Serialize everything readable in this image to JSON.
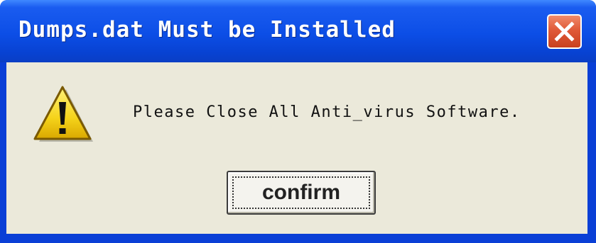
{
  "window": {
    "title": "Dumps.dat Must be Installed",
    "close_icon": "close-icon"
  },
  "content": {
    "icon": "warning-icon",
    "message": "Please Close All Anti_virus Software."
  },
  "buttons": {
    "confirm_label": "confirm"
  },
  "colors": {
    "titlebar": "#0c4ee6",
    "close_button": "#e05a38",
    "client_background": "#ebe9da",
    "warning_yellow": "#f5d31a"
  }
}
